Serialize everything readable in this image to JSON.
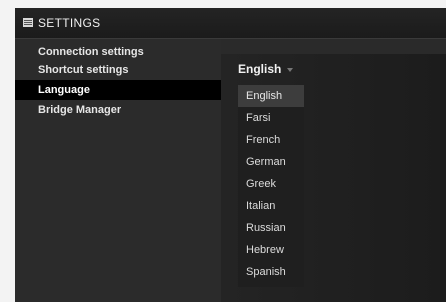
{
  "window": {
    "title": "SETTINGS",
    "title_icon": "settings-icon"
  },
  "sidebar": {
    "items": [
      {
        "label": "Connection settings",
        "selected": false
      },
      {
        "label": "Shortcut settings",
        "selected": false
      },
      {
        "label": "Language",
        "selected": true
      },
      {
        "label": "Bridge Manager",
        "selected": false
      }
    ]
  },
  "language": {
    "selected_value": "English",
    "dropdown_open": true,
    "options": [
      "English",
      "Farsi",
      "French",
      "German",
      "Greek",
      "Italian",
      "Russian",
      "Hebrew",
      "Spanish"
    ],
    "highlighted_option": "English"
  },
  "colors": {
    "window_bg": "#2e2e2e",
    "titlebar_bg": "#1b1b1b",
    "selected_nav_bg": "#000000",
    "dropdown_bg": "#1f1f1f",
    "highlight_bg": "#3d3d3d",
    "text": "#e6e6e6"
  }
}
